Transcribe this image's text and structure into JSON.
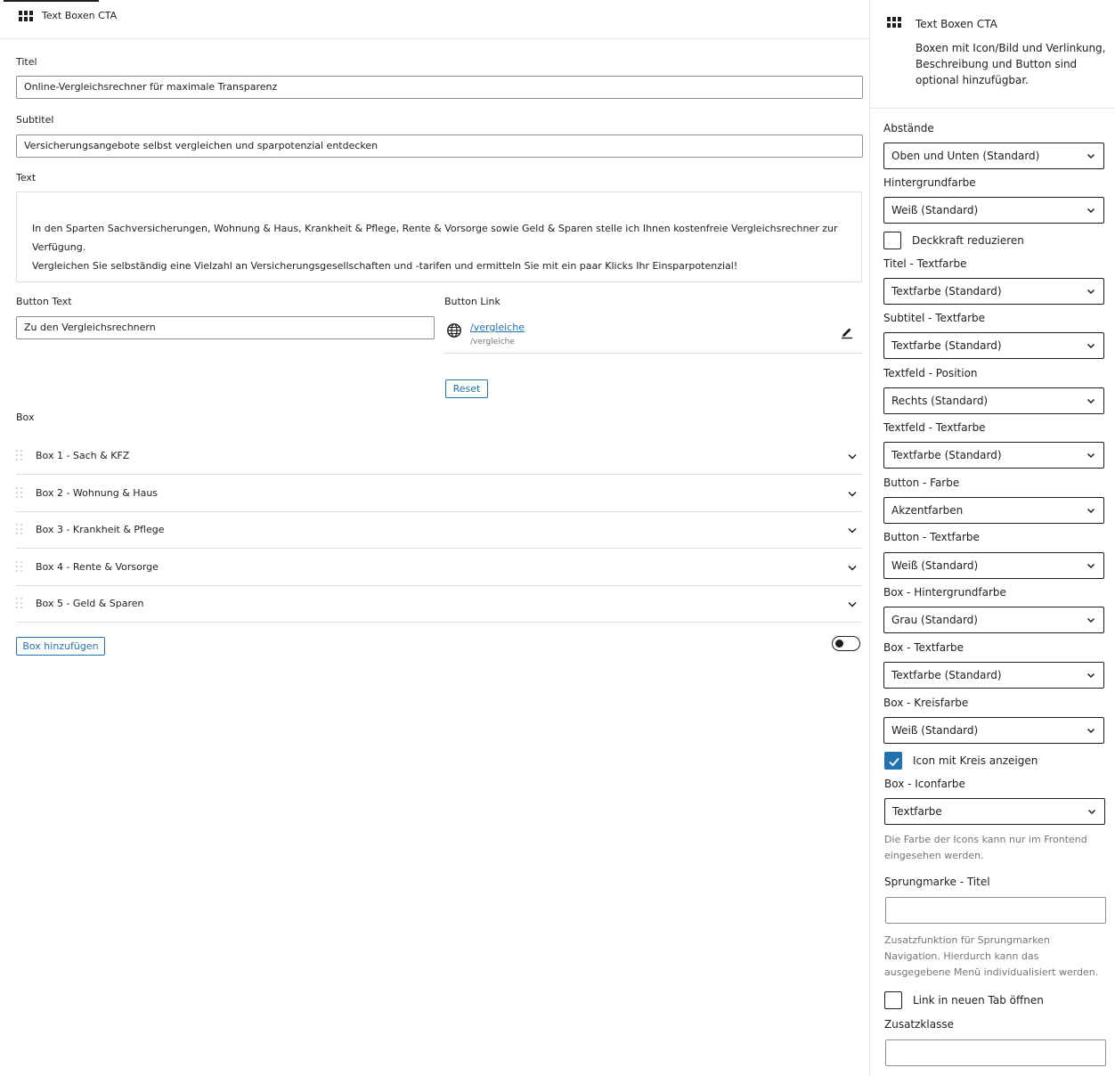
{
  "editor": {
    "block_title": "Text Boxen CTA",
    "titel": {
      "label": "Titel",
      "value": "Online-Vergleichsrechner für maximale Transparenz"
    },
    "subtitel": {
      "label": "Subtitel",
      "value": "Versicherungsangebote selbst vergleichen und sparpotenzial entdecken"
    },
    "text": {
      "label": "Text",
      "line1": "In den Sparten Sachversicherungen, Wohnung & Haus, Krankheit & Pflege, Rente & Vorsorge sowie Geld & Sparen stelle ich Ihnen kostenfreie Vergleichsrechner zur Verfügung.",
      "line2": "Vergleichen Sie selbständig eine Vielzahl an Versicherungsgesellschaften und -tarifen und ermitteln Sie mit ein paar Klicks Ihr Einsparpotenzial!"
    },
    "button_text": {
      "label": "Button Text",
      "value": "Zu den Vergleichsrechnern"
    },
    "button_link": {
      "label": "Button Link",
      "url": "/vergleiche",
      "sub": "/vergleiche"
    },
    "reset_label": "Reset",
    "box_label": "Box",
    "boxes": [
      "Box 1 - Sach & KFZ",
      "Box 2 - Wohnung & Haus",
      "Box 3 - Krankheit & Pflege",
      "Box 4 - Rente & Vorsorge",
      "Box 5 - Geld & Sparen"
    ],
    "add_box_label": "Box hinzufügen",
    "toggle_on": false
  },
  "sidebar": {
    "title": "Text Boxen CTA",
    "description": "Boxen mit Icon/Bild und Verlinkung, Beschreibung und Button sind optional hinzufügbar.",
    "abstaende": {
      "label": "Abstände",
      "value": "Oben und Unten (Standard)"
    },
    "hintergrundfarbe": {
      "label": "Hintergrundfarbe",
      "value": "Weiß (Standard)"
    },
    "deckkraft": {
      "label": "Deckkraft reduzieren",
      "checked": false
    },
    "titel_textfarbe": {
      "label": "Titel - Textfarbe",
      "value": "Textfarbe (Standard)"
    },
    "subtitel_textfarbe": {
      "label": "Subtitel - Textfarbe",
      "value": "Textfarbe (Standard)"
    },
    "textfeld_position": {
      "label": "Textfeld - Position",
      "value": "Rechts (Standard)"
    },
    "textfeld_textfarbe": {
      "label": "Textfeld - Textfarbe",
      "value": "Textfarbe (Standard)"
    },
    "button_farbe": {
      "label": "Button - Farbe",
      "value": "Akzentfarben"
    },
    "button_textfarbe": {
      "label": "Button - Textfarbe",
      "value": "Weiß (Standard)"
    },
    "box_hintergrundfarbe": {
      "label": "Box - Hintergrundfarbe",
      "value": "Grau (Standard)"
    },
    "box_textfarbe": {
      "label": "Box - Textfarbe",
      "value": "Textfarbe (Standard)"
    },
    "box_kreisfarbe": {
      "label": "Box - Kreisfarbe",
      "value": "Weiß (Standard)"
    },
    "icon_kreis": {
      "label": "Icon mit Kreis anzeigen",
      "checked": true
    },
    "box_iconfarbe": {
      "label": "Box - Iconfarbe",
      "value": "Textfarbe"
    },
    "iconfarbe_help": "Die Farbe der Icons kann nur im Frontend eingesehen werden.",
    "sprungmarke": {
      "label": "Sprungmarke - Titel",
      "value": ""
    },
    "sprungmarke_help": "Zusatzfunktion für Sprungmarken Navigation. Hierdurch kann das ausgegebene Menü individualisiert werden.",
    "neuer_tab": {
      "label": "Link in neuen Tab öffnen",
      "checked": false
    },
    "zusatzklasse": {
      "label": "Zusatzklasse",
      "value": ""
    }
  },
  "colors": {
    "accent": "#2271b1",
    "text": "#1e1e1e",
    "muted": "#757575",
    "border": "#e0e0e0"
  }
}
